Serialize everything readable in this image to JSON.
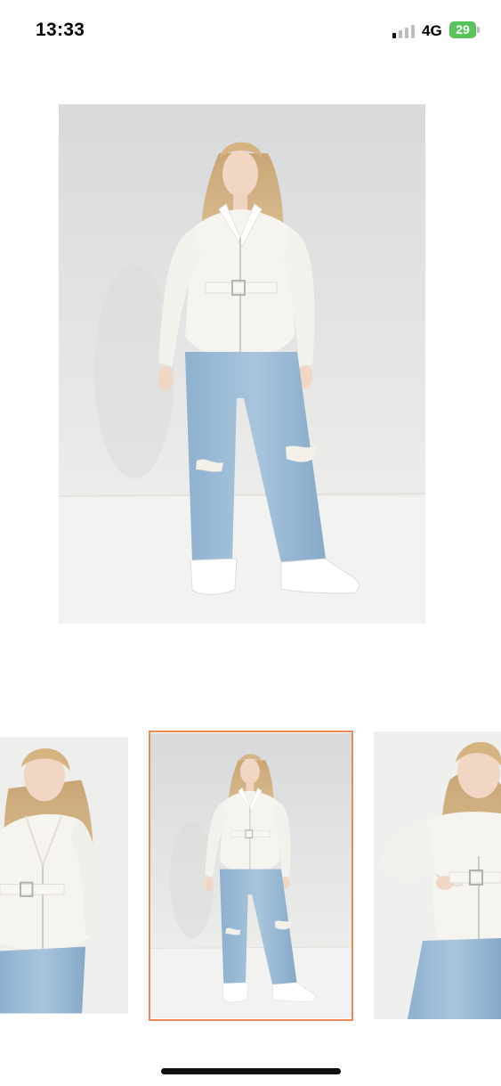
{
  "status_bar": {
    "time": "13:33",
    "network": "4G",
    "battery_level": "29",
    "signal_bars_active": 1,
    "signal_bars_total": 4,
    "battery_color": "#5ac35e"
  },
  "gallery": {
    "selected_index": 1,
    "accent_color": "#ec8a57",
    "thumbnails": [
      {
        "id": "thumb-close-up"
      },
      {
        "id": "thumb-full-length"
      },
      {
        "id": "thumb-hand-on-hip"
      }
    ]
  }
}
